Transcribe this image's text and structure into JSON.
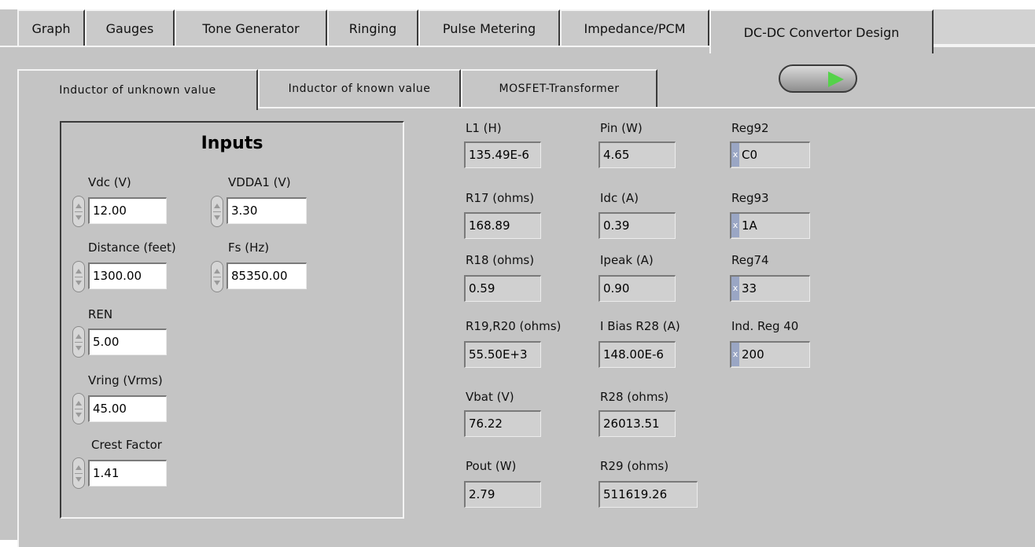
{
  "tabs": [
    {
      "label": "Graph"
    },
    {
      "label": "Gauges"
    },
    {
      "label": "Tone Generator"
    },
    {
      "label": "Ringing"
    },
    {
      "label": "Pulse Metering"
    },
    {
      "label": "Impedance/PCM"
    },
    {
      "label": "DC-DC Convertor Design",
      "active": true
    }
  ],
  "subtabs": [
    {
      "label": "Inductor of unknown value",
      "active": true
    },
    {
      "label": "Inductor of known value"
    },
    {
      "label": "MOSFET-Transformer"
    }
  ],
  "run_button": {
    "icon": "run-arrow-icon",
    "arrow_color": "#55d24a"
  },
  "inputs": {
    "title": "Inputs",
    "vdc": {
      "label": "Vdc (V)",
      "value": "12.00"
    },
    "vdda1": {
      "label": "VDDA1 (V)",
      "value": "3.30"
    },
    "distance": {
      "label": "Distance (feet)",
      "value": "1300.00"
    },
    "fs": {
      "label": "Fs (Hz)",
      "value": "85350.00"
    },
    "ren": {
      "label": "REN",
      "value": "5.00"
    },
    "vring": {
      "label": "Vring (Vrms)",
      "value": "45.00"
    },
    "crest": {
      "label": "Crest Factor",
      "value": "1.41"
    }
  },
  "outputs": {
    "col1": [
      {
        "label": "L1 (H)",
        "value": "135.49E-6"
      },
      {
        "label": "R17 (ohms)",
        "value": "168.89"
      },
      {
        "label": "R18 (ohms)",
        "value": "0.59"
      },
      {
        "label": "R19,R20 (ohms)",
        "value": "55.50E+3"
      },
      {
        "label": "Vbat (V)",
        "value": "76.22"
      },
      {
        "label": "Pout (W)",
        "value": "2.79"
      }
    ],
    "col2": [
      {
        "label": "Pin (W)",
        "value": "4.65"
      },
      {
        "label": "Idc (A)",
        "value": "0.39"
      },
      {
        "label": "Ipeak (A)",
        "value": "0.90"
      },
      {
        "label": "I Bias R28 (A)",
        "value": "148.00E-6"
      },
      {
        "label": "R28 (ohms)",
        "value": "26013.51"
      },
      {
        "label": "R29 (ohms)",
        "value": "511619.26"
      }
    ],
    "registers": [
      {
        "label": "Reg92",
        "radix": "x",
        "value": "C0"
      },
      {
        "label": "Reg93",
        "radix": "x",
        "value": "1A"
      },
      {
        "label": "Reg74",
        "radix": "x",
        "value": "33"
      },
      {
        "label": "Ind. Reg 40",
        "radix": "x",
        "value": "200"
      }
    ]
  }
}
